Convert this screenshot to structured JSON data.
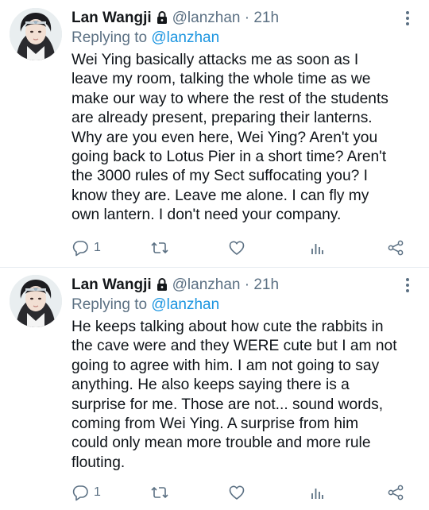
{
  "tweets": [
    {
      "author_name": "Lan Wangji",
      "handle": "@lanzhan",
      "separator": "·",
      "time": "21h",
      "replying_prefix": "Replying to",
      "replying_to": "@lanzhan",
      "text": "Wei Ying basically attacks me as soon as I\nleave my room, talking the whole time as we\nmake our way to where the rest of the students\nare already present, preparing their lanterns.\nWhy are you even here, Wei Ying? Aren't you\ngoing back to Lotus Pier in a short time? Aren't\nthe 3000 rules of my Sect suffocating you? I\nknow they are. Leave me alone. I can fly my\nown lantern. I don't need your company.",
      "reply_count": "1",
      "icons": [
        "lock-icon",
        "more-icon",
        "reply-icon",
        "retweet-icon",
        "like-icon",
        "stats-icon",
        "share-icon"
      ]
    },
    {
      "author_name": "Lan Wangji",
      "handle": "@lanzhan",
      "separator": "·",
      "time": "21h",
      "replying_prefix": "Replying to",
      "replying_to": "@lanzhan",
      "text": "He keeps talking about how cute the rabbits in\nthe cave were and they WERE cute but I am not\ngoing to agree with him. I am not going to say\nanything. He also keeps saying there is a\nsurprise for me. Those are not... sound words,\ncoming from Wei Ying. A surprise from him\ncould only mean more trouble and more rule\nflouting.",
      "reply_count": "1",
      "icons": [
        "lock-icon",
        "more-icon",
        "reply-icon",
        "retweet-icon",
        "like-icon",
        "stats-icon",
        "share-icon"
      ]
    }
  ],
  "colors": {
    "text": "#0f1419",
    "secondary": "#5b7083",
    "link": "#1b95e0",
    "divider": "#e6ecf0"
  }
}
